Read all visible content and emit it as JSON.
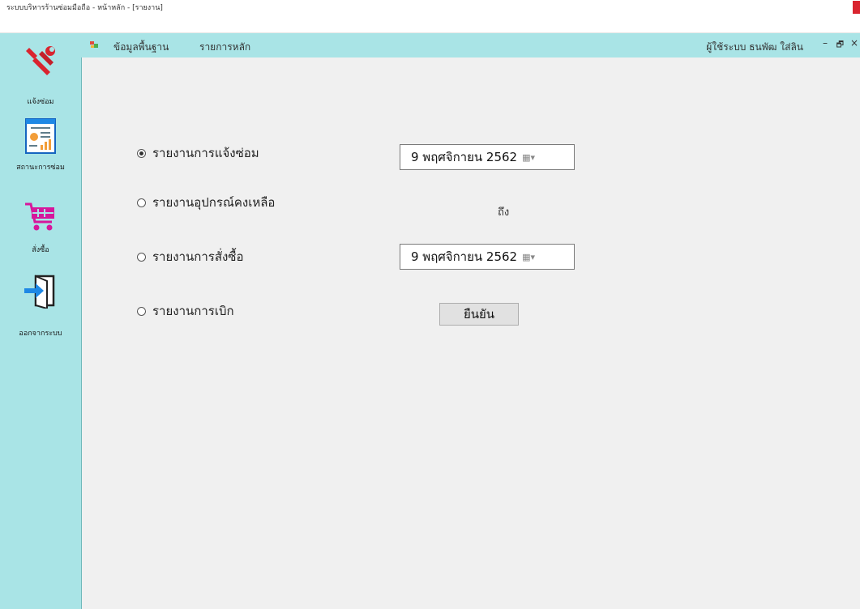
{
  "window": {
    "title": "ระบบบริหารร้านซ่อมมือถือ - หน้าหลัก - [รายงาน]"
  },
  "menubar": {
    "items": [
      {
        "label": "ข้อมูลพื้นฐาน"
      },
      {
        "label": "รายการหลัก"
      }
    ],
    "user_label": "ผู้ใช้ระบบ ธนพัฒ ใส่ลิน",
    "minimize": "–",
    "restore": "🗗",
    "close": "×"
  },
  "sidebar": {
    "items": [
      {
        "label": "แจ้งซ่อม",
        "icon": "wrench-icon"
      },
      {
        "label": "สถานะการซ่อม",
        "icon": "report-chart-icon"
      },
      {
        "label": "สั่งซื้อ",
        "icon": "shopping-cart-icon"
      },
      {
        "label": "ออกจากระบบ",
        "icon": "logout-icon"
      }
    ]
  },
  "report": {
    "options": [
      {
        "label": "รายงานการแจ้งซ่อม",
        "checked": true
      },
      {
        "label": "รายงานอุปกรณ์คงเหลือ",
        "checked": false
      },
      {
        "label": "รายงานการสั่งซื้อ",
        "checked": false
      },
      {
        "label": "รายงานการเบิก",
        "checked": false
      }
    ],
    "date_from": "9 พฤศจิกายน  2562",
    "to_label": "ถึง",
    "date_to": "9 พฤศจิกายน  2562",
    "confirm_label": "ยืนยัน"
  },
  "colors": {
    "accent": "#a9e4e6",
    "content_bg": "#f0f0f0",
    "icon_red": "#d9242f",
    "icon_blue": "#1e88e5",
    "cart_magenta": "#d6179c"
  }
}
